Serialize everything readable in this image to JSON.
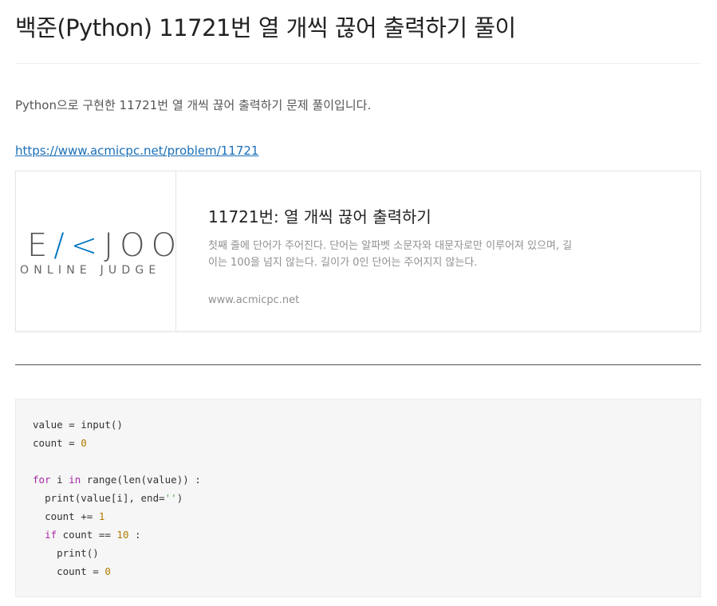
{
  "article": {
    "title": "백준(Python) 11721번 열 개씩 끊어 출력하기 풀이",
    "intro": "Python으로 구현한 11721번 열 개씩 끊어 출력하기 문제 풀이입니다.",
    "link_text": "https://www.acmicpc.net/problem/11721"
  },
  "link_card": {
    "logo_text_left": "E",
    "logo_text_accent": "/<",
    "logo_text_right": "JOO",
    "logo_subtext": "ONLINE JUDGE",
    "title": "11721번: 열 개씩 끊어 출력하기",
    "description": "첫째 줄에 단어가 주어진다. 단어는 알파벳 소문자와 대문자로만 이루어져 있으며, 길이는 100을 넘지 않는다. 길이가 0인 단어는 주어지지 않는다.",
    "host": "www.acmicpc.net"
  },
  "code": {
    "language": "python",
    "lines": [
      "value = input()",
      "count = 0",
      "",
      "for i in range(len(value)) :",
      "  print(value[i], end='')",
      "  count += 1",
      "  if count == 10 :",
      "    print()",
      "    count = 0"
    ]
  },
  "colors": {
    "link": "#1a6fb8",
    "logo_accent": "#0076c0",
    "keyword": "#a626a4",
    "number": "#b07b00",
    "string": "#50a14f",
    "code_background": "#f6f6f6"
  }
}
